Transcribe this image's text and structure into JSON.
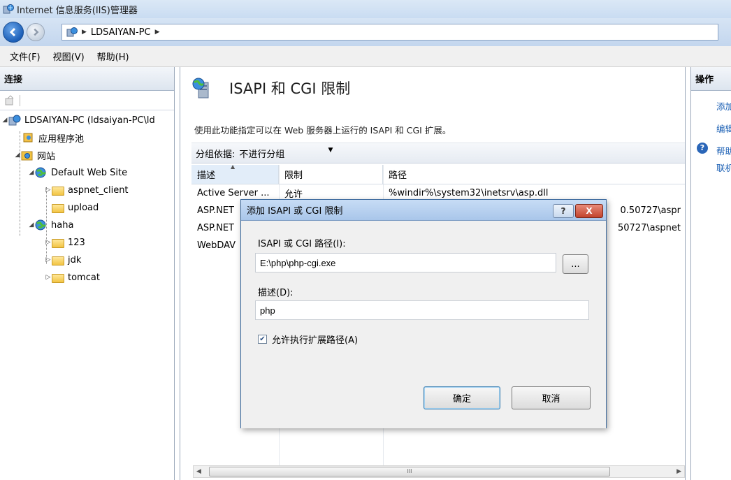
{
  "window": {
    "title": "Internet 信息服务(IIS)管理器"
  },
  "address": {
    "crumb": "LDSAIYAN-PC"
  },
  "menu": {
    "file": "文件(F)",
    "view": "视图(V)",
    "help": "帮助(H)"
  },
  "connections": {
    "header": "连接",
    "tree": {
      "server": "LDSAIYAN-PC (ldsaiyan-PC\\ld",
      "app_pools": "应用程序池",
      "sites": "网站",
      "default_site": "Default Web Site",
      "aspnet_client": "aspnet_client",
      "upload": "upload",
      "haha": "haha",
      "f123": "123",
      "jdk": "jdk",
      "tomcat": "tomcat"
    }
  },
  "feature": {
    "title": "ISAPI 和 CGI 限制",
    "description": "使用此功能指定可以在 Web 服务器上运行的 ISAPI 和 CGI 扩展。",
    "group_label": "分组依据:",
    "group_value": "不进行分组",
    "columns": {
      "desc": "描述",
      "restriction": "限制",
      "path": "路径"
    },
    "rows": [
      {
        "desc": "Active Server ...",
        "restriction": "允许",
        "path": "%windir%\\system32\\inetsrv\\asp.dll"
      },
      {
        "desc": "ASP.NET",
        "restriction": "",
        "path": "0.50727\\aspr"
      },
      {
        "desc": "ASP.NET",
        "restriction": "",
        "path": "50727\\aspnet"
      },
      {
        "desc": "WebDAV",
        "restriction": "",
        "path": ""
      }
    ],
    "scroll_thumb": "III"
  },
  "actions": {
    "header": "操作",
    "add": "添加",
    "edit": "编辑",
    "help": "帮助",
    "online": "联机"
  },
  "dialog": {
    "title": "添加 ISAPI 或 CGI 限制",
    "help_btn": "?",
    "close_btn": "X",
    "path_label": "ISAPI 或 CGI 路径(I):",
    "path_value": "E:\\php\\php-cgi.exe",
    "browse": "...",
    "desc_label": "描述(D):",
    "desc_value": "php",
    "checkbox_label": "允许执行扩展路径(A)",
    "checkbox_checked": true,
    "ok": "确定",
    "cancel": "取消"
  },
  "colors": {
    "accent": "#1a5fb4",
    "titlebar": "#c9dcf2",
    "dialog_border": "#3e6b9e",
    "close_red": "#c2432c"
  }
}
